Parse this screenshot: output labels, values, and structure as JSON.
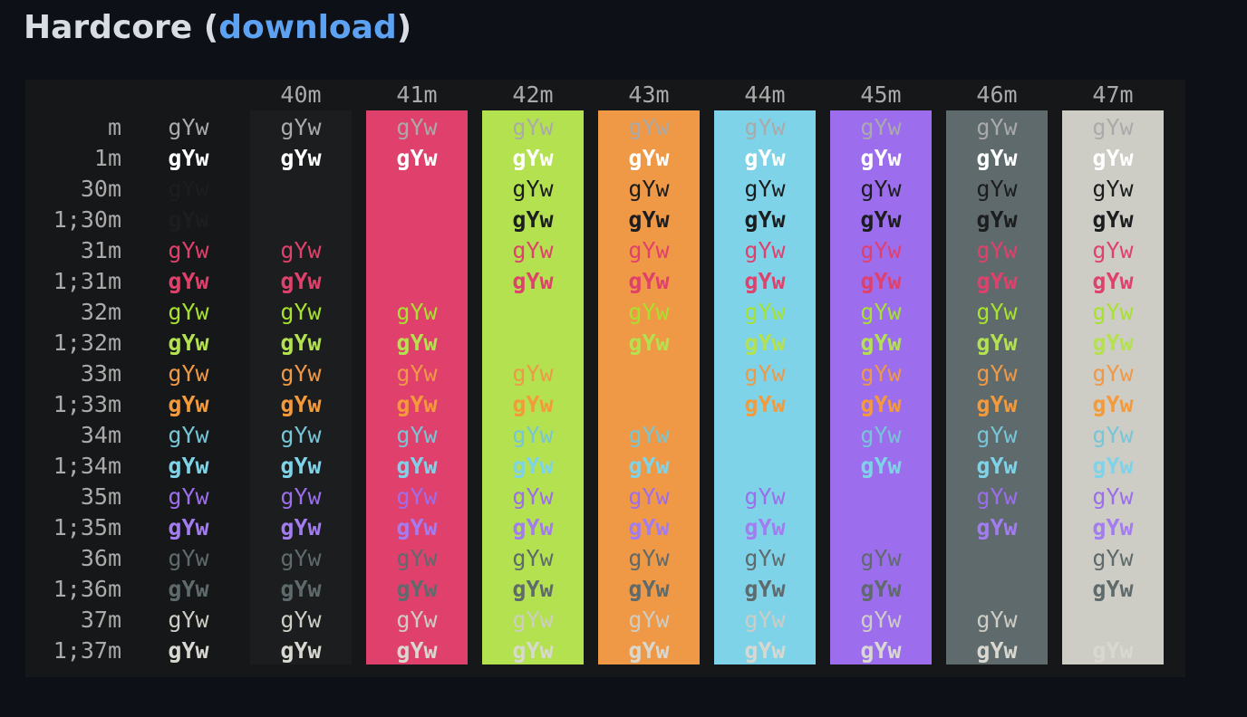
{
  "heading": {
    "title": "Hardcore",
    "open": "(",
    "link_text": "download",
    "close": ")"
  },
  "sample_text": "gYw",
  "columns": [
    {
      "label": "",
      "bg": "#151718"
    },
    {
      "label": "40m",
      "bg": "#1b1d1e"
    },
    {
      "label": "41m",
      "bg": "#e0416c"
    },
    {
      "label": "42m",
      "bg": "#b3e14f"
    },
    {
      "label": "43m",
      "bg": "#ef9946"
    },
    {
      "label": "44m",
      "bg": "#7fd3e8"
    },
    {
      "label": "45m",
      "bg": "#9c6eed"
    },
    {
      "label": "46m",
      "bg": "#5f6a6c"
    },
    {
      "label": "47m",
      "bg": "#cdcdc5"
    }
  ],
  "rows": [
    {
      "label": "m",
      "fg": "#aaaaaa",
      "bold": false
    },
    {
      "label": "1m",
      "fg": "#ffffff",
      "bold": true
    },
    {
      "label": "30m",
      "fg": "#1b1d1e",
      "bold": false
    },
    {
      "label": "1;30m",
      "fg": "#1b1d1e",
      "bold": true
    },
    {
      "label": "31m",
      "fg": "#e0416c",
      "bold": false
    },
    {
      "label": "1;31m",
      "fg": "#e0416c",
      "bold": true
    },
    {
      "label": "32m",
      "fg": "#a6e22e",
      "bold": false
    },
    {
      "label": "1;32m",
      "fg": "#b3e14f",
      "bold": true
    },
    {
      "label": "33m",
      "fg": "#ef9946",
      "bold": false
    },
    {
      "label": "1;33m",
      "fg": "#f49a3a",
      "bold": true
    },
    {
      "label": "34m",
      "fg": "#76c6d8",
      "bold": false
    },
    {
      "label": "1;34m",
      "fg": "#7fd3e8",
      "bold": true
    },
    {
      "label": "35m",
      "fg": "#9c6eed",
      "bold": false
    },
    {
      "label": "1;35m",
      "fg": "#a27cf0",
      "bold": true
    },
    {
      "label": "36m",
      "fg": "#5f6a6c",
      "bold": false
    },
    {
      "label": "1;36m",
      "fg": "#5f6a6c",
      "bold": true
    },
    {
      "label": "37m",
      "fg": "#cdcdc5",
      "bold": false
    },
    {
      "label": "1;37m",
      "fg": "#d8d8d0",
      "bold": true
    }
  ],
  "hidden_cells": [
    [
      2,
      2
    ],
    [
      3,
      2
    ],
    [
      4,
      2
    ],
    [
      5,
      2
    ],
    [
      6,
      3
    ],
    [
      7,
      3
    ],
    [
      8,
      4
    ],
    [
      9,
      4
    ],
    [
      10,
      5
    ],
    [
      11,
      5
    ],
    [
      12,
      6
    ],
    [
      13,
      6
    ],
    [
      14,
      7
    ],
    [
      15,
      7
    ]
  ]
}
